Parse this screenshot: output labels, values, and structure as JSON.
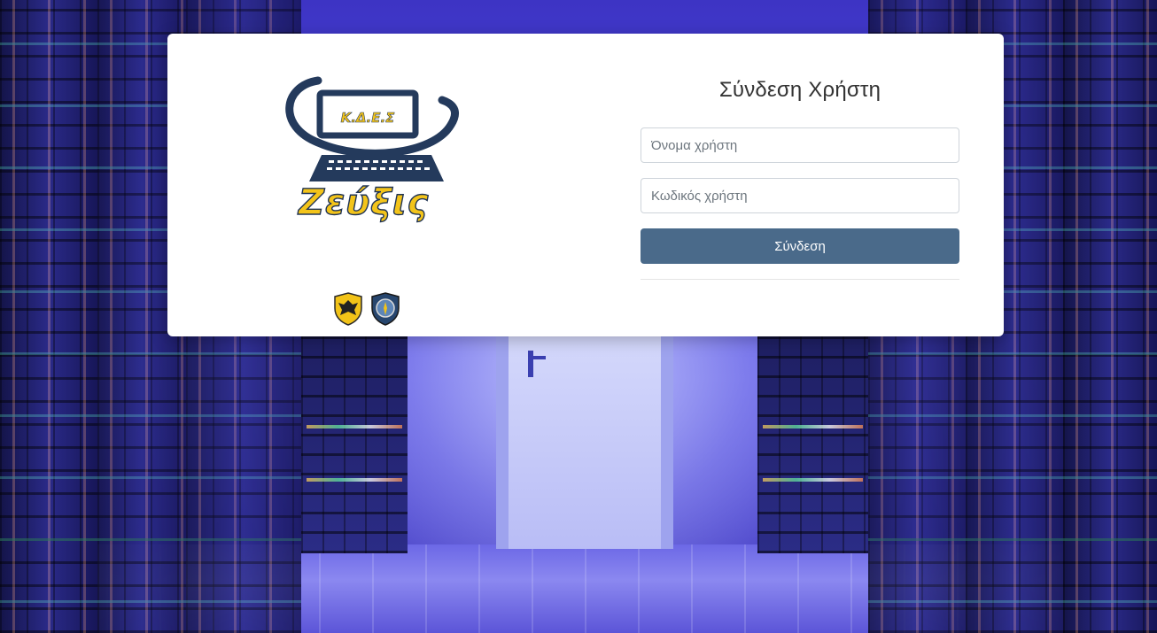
{
  "logo": {
    "org_label": "Κ.Δ.Ε.Σ",
    "app_name": "Ζεύξις"
  },
  "login": {
    "title": "Σύνδεση Χρήστη",
    "username_placeholder": "Όνομα χρήστη",
    "password_placeholder": "Κωδικός χρήστη",
    "submit_label": "Σύνδεση"
  },
  "colors": {
    "button": "#4a6a8a",
    "logo_gold": "#f3c41a",
    "logo_navy": "#1f3355"
  },
  "icons": [
    "monitor-logo-icon",
    "hellenic-army-emblem-icon",
    "unit-emblem-icon"
  ]
}
